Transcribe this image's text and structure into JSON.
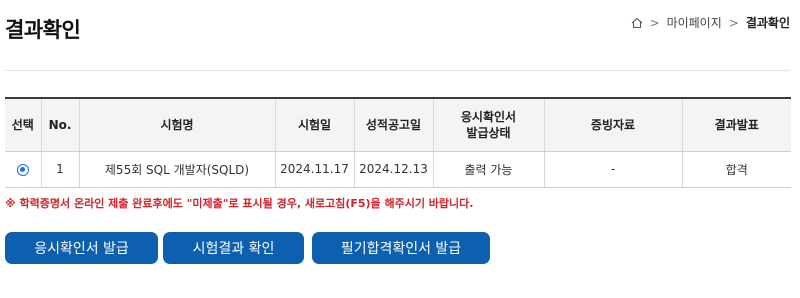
{
  "page": {
    "title": "결과확인"
  },
  "breadcrumb": {
    "home_icon": "home-icon",
    "items": [
      "마이페이지",
      "결과확인"
    ],
    "separator": ">"
  },
  "table": {
    "headers": [
      "선택",
      "No.",
      "시험명",
      "시험일",
      "성적공고일",
      "응시확인서\n발급상태",
      "증빙자료",
      "결과발표"
    ],
    "rows": [
      {
        "selected": true,
        "no": "1",
        "exam": "제55회 SQL 개발자(SQLD)",
        "exam_date": "2024.11.17",
        "score_date": "2024.12.13",
        "status": "출력 가능",
        "evidence": "-",
        "result": "합격"
      }
    ]
  },
  "notice": "※ 학력증명서 온라인 제출 완료후에도 \"미제출\"로 표시될 경우, 새로고침(F5)을 해주시기 바랍니다.",
  "buttons": {
    "issue_certificate": "응시확인서 발급",
    "check_result": "시험결과 확인",
    "written_pass_certificate": "필기합격확인서 발급"
  },
  "colors": {
    "primary_button": "#0d5fb0",
    "notice_red": "#d2232a",
    "radio_blue": "#1a73e8"
  }
}
